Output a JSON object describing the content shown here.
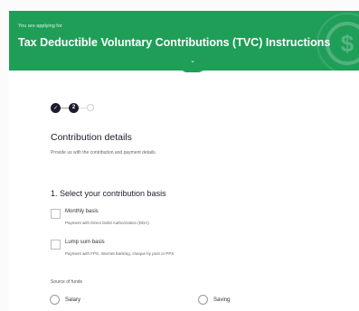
{
  "banner": {
    "applying_label": "You are applying for",
    "title": "Tax Deductible Voluntary Contributions (TVC) Instructions",
    "coin_symbol": "$",
    "expand_symbol": "⌄",
    "color": "#1f9e58"
  },
  "stepper": {
    "steps": [
      {
        "state": "done",
        "symbol": "✓"
      },
      {
        "state": "current",
        "symbol": "2"
      },
      {
        "state": "upcoming",
        "symbol": ""
      }
    ]
  },
  "section": {
    "title": "Contribution details",
    "subtitle": "Provide us with the contribution and payment details."
  },
  "basis": {
    "question": "1. Select your contribution basis",
    "options": [
      {
        "label": "Monthly basis",
        "hint": "Payment with Direct Debit Authorization (DDA)"
      },
      {
        "label": "Lump sum basis",
        "hint": "Payment with FPS, Internet banking, cheque by post or PPS"
      }
    ]
  },
  "funds": {
    "label": "Source of funds",
    "options": [
      {
        "label": "Salary"
      },
      {
        "label": "Saving"
      }
    ]
  }
}
